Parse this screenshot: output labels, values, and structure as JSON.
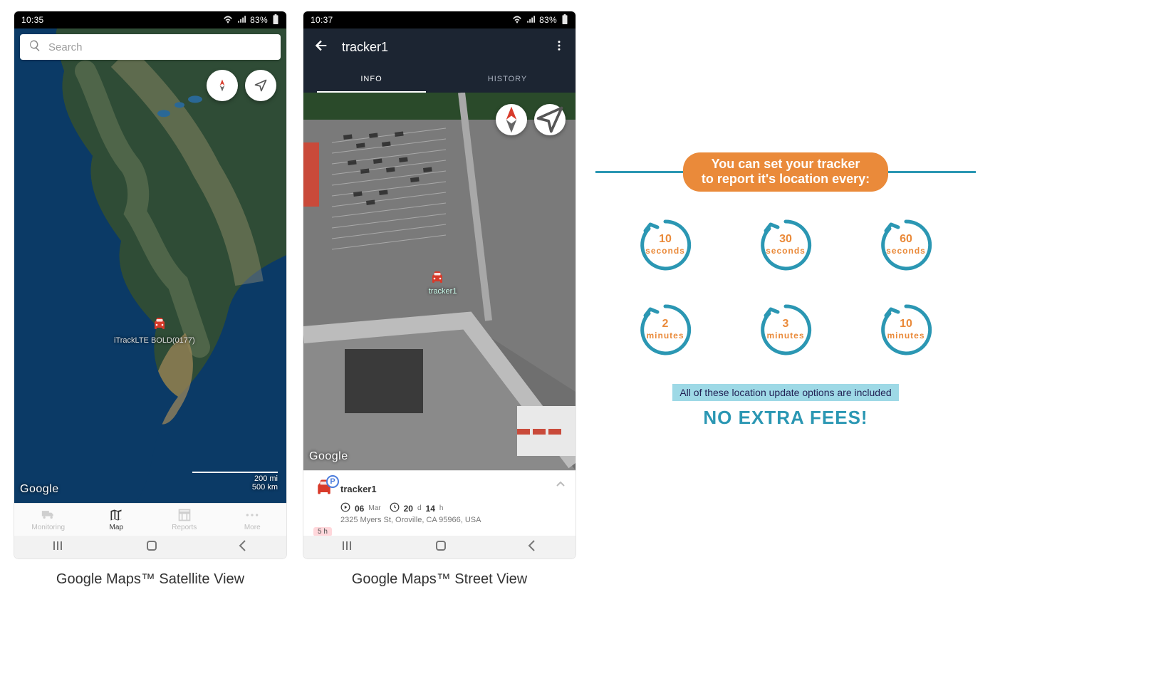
{
  "phone1": {
    "status_time": "10:35",
    "status_battery": "83%",
    "search_placeholder": "Search",
    "marker_label": "iTrackLTE BOLD(0177)",
    "google_logo": "Google",
    "scale_top": "200 mi",
    "scale_bottom": "500 km",
    "bottom_nav": [
      {
        "label": "Monitoring"
      },
      {
        "label": "Map"
      },
      {
        "label": "Reports"
      },
      {
        "label": "More"
      }
    ],
    "caption": "Google Maps™ Satellite View"
  },
  "phone2": {
    "status_time": "10:37",
    "status_battery": "83%",
    "title": "tracker1",
    "tab_info": "INFO",
    "tab_history": "HISTORY",
    "google_logo": "Google",
    "map_label": "tracker1",
    "card": {
      "name": "tracker1",
      "park_badge": "P",
      "date_num": "06",
      "date_unit": "Mar",
      "dur_d": "20",
      "dur_d_unit": "d",
      "dur_h": "14",
      "dur_h_unit": "h",
      "address": "2325 Myers St, Oroville, CA 95966, USA",
      "stale": "5 h"
    },
    "caption": "Google Maps™ Street View"
  },
  "promo": {
    "headline_l1": "You can set your tracker",
    "headline_l2": "to report it's location every:",
    "options": [
      {
        "num": "10",
        "unit": "seconds"
      },
      {
        "num": "30",
        "unit": "seconds"
      },
      {
        "num": "60",
        "unit": "seconds"
      },
      {
        "num": "2",
        "unit": "minutes"
      },
      {
        "num": "3",
        "unit": "minutes"
      },
      {
        "num": "10",
        "unit": "minutes"
      }
    ],
    "bar": "All of these location update options are included",
    "shout": "NO EXTRA FEES!"
  }
}
